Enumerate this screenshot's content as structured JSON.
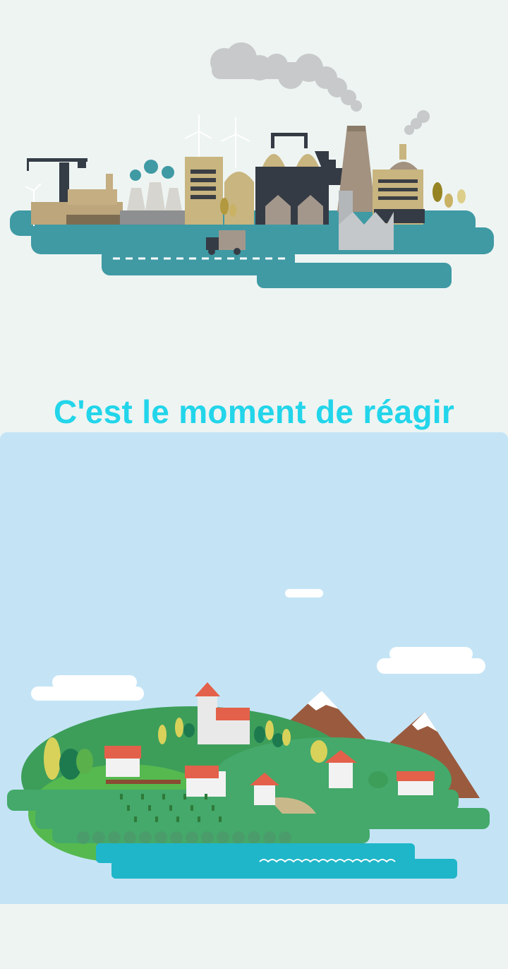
{
  "headline": "C'est le moment de réagir",
  "colors": {
    "top_background": "#eef4f2",
    "bottom_background": "#c4e4f6",
    "headline": "#22d5ea",
    "water": "#3f9aa4",
    "grass": "#44a96a",
    "sea": "#1fb6c9"
  },
  "illustrations": {
    "industrial": "industrial-city-illustration",
    "countryside": "green-village-illustration"
  }
}
